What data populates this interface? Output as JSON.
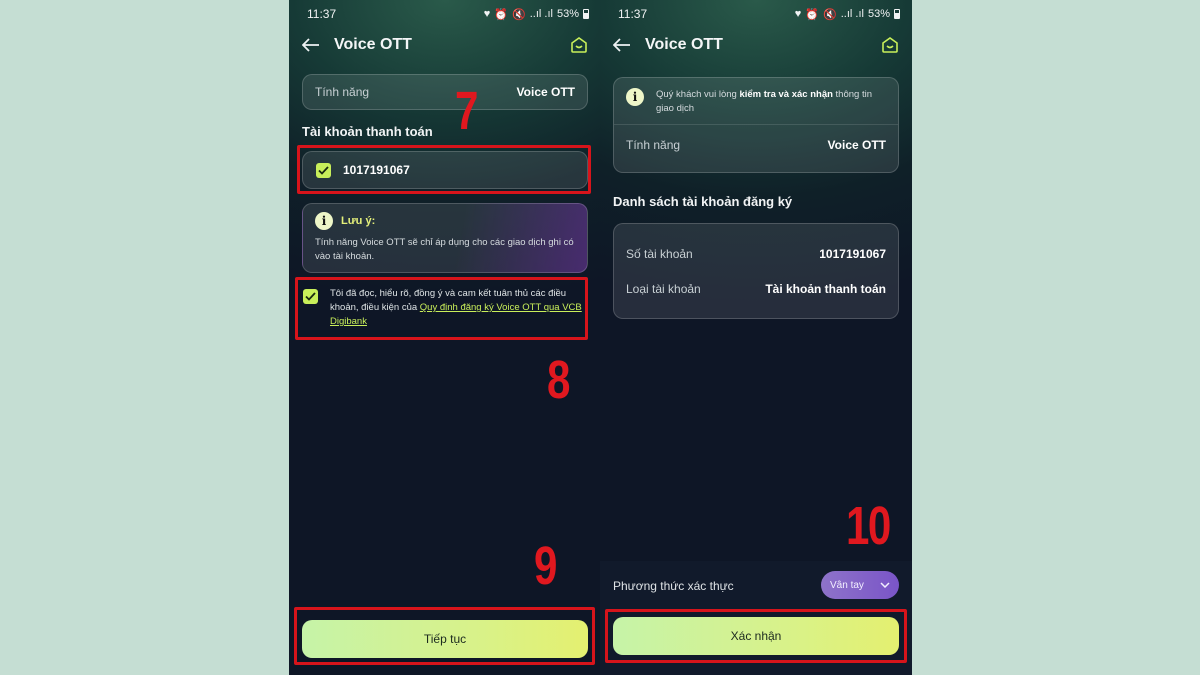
{
  "left": {
    "status": {
      "time": "11:37",
      "battery": "53%",
      "signal": "..ıl .ıl"
    },
    "header": {
      "title": "Voice OTT"
    },
    "feature_row": {
      "label": "Tính năng",
      "value": "Voice OTT"
    },
    "account_section": {
      "title": "Tài khoản thanh toán",
      "account_number": "1017191067"
    },
    "note": {
      "title": "Lưu ý:",
      "body": "Tính năng Voice OTT sẽ chỉ áp dụng cho các giao dịch ghi có vào tài khoản."
    },
    "terms": {
      "text": "Tôi đã đọc, hiểu rõ, đồng ý và cam kết tuân thủ các điều khoản, điều kiện của ",
      "link": "Quy định đăng ký Voice OTT qua VCB Digibank"
    },
    "continue_label": "Tiếp tục"
  },
  "right": {
    "status": {
      "time": "11:37",
      "battery": "53%",
      "signal": "..ıl .ıl"
    },
    "header": {
      "title": "Voice OTT"
    },
    "confirm_card": {
      "notice_prefix": "Quý khách vui lòng ",
      "notice_bold": "kiểm tra và xác nhận",
      "notice_suffix": " thông tin giao dịch",
      "feature_label": "Tính năng",
      "feature_value": "Voice OTT"
    },
    "list_section": {
      "title": "Danh sách tài khoản đăng ký",
      "account_no_label": "Số tài khoản",
      "account_no_value": "1017191067",
      "account_type_label": "Loại tài khoản",
      "account_type_value": "Tài khoản thanh toán"
    },
    "auth": {
      "label": "Phương thức xác thực",
      "selected": "Vân tay"
    },
    "confirm_label": "Xác nhận"
  },
  "annotations": {
    "step7": "7",
    "step8": "8",
    "step9": "9",
    "step10": "10"
  },
  "colors": {
    "accent": "#c8ef5a",
    "highlight": "#d7141b",
    "dropdown": "#7a55c8",
    "background": "#c5ded3"
  }
}
